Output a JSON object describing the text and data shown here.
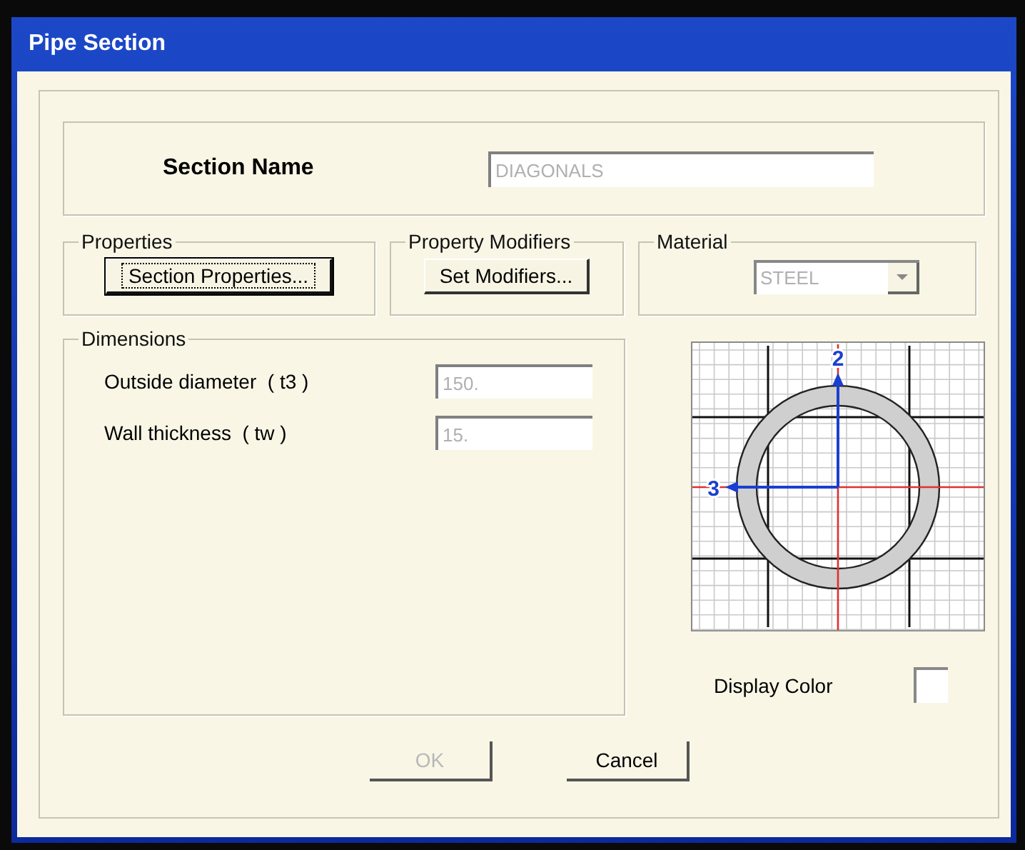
{
  "window": {
    "title": "Pipe Section"
  },
  "section_name": {
    "label": "Section Name",
    "value": "DIAGONALS",
    "disabled": true
  },
  "groups": [
    {
      "kind": "button",
      "legend": "Properties",
      "button": {
        "label": "Section Properties...",
        "default": true
      }
    },
    {
      "kind": "button",
      "legend": "Property Modifiers",
      "button": {
        "label": "Set Modifiers...",
        "default": false
      }
    },
    {
      "kind": "dropdown",
      "legend": "Material",
      "value": "STEEL",
      "disabled": true
    }
  ],
  "dimensions": {
    "legend": "Dimensions",
    "fields": [
      {
        "label": "Outside diameter  ( t3 )",
        "value": "150.",
        "disabled": true
      },
      {
        "label": "Wall thickness  ( tw )",
        "value": "15.",
        "disabled": true
      }
    ]
  },
  "diagram": {
    "axis_labels": [
      "2",
      "3"
    ]
  },
  "display_color": {
    "label": "Display Color",
    "color": "#ffffff"
  },
  "buttons": [
    {
      "label": "OK",
      "disabled": true
    },
    {
      "label": "Cancel",
      "disabled": false
    }
  ]
}
